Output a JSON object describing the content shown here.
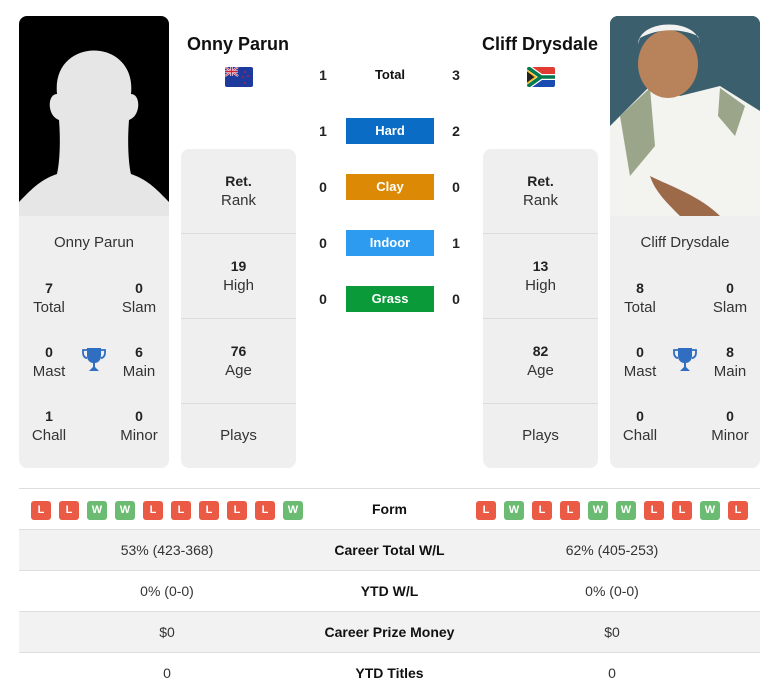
{
  "players": {
    "left": {
      "name": "Onny Parun",
      "flag": "new-zealand-flag",
      "titles": {
        "total": {
          "value": "7",
          "label": "Total"
        },
        "slam": {
          "value": "0",
          "label": "Slam"
        },
        "mast": {
          "value": "0",
          "label": "Mast"
        },
        "main": {
          "value": "6",
          "label": "Main"
        },
        "chall": {
          "value": "1",
          "label": "Chall"
        },
        "minor": {
          "value": "0",
          "label": "Minor"
        }
      },
      "rank": {
        "value": "Ret.",
        "label": "Rank"
      },
      "high": {
        "value": "19",
        "label": "High"
      },
      "age": {
        "value": "76",
        "label": "Age"
      },
      "plays": {
        "label": "Plays"
      }
    },
    "right": {
      "name": "Cliff Drysdale",
      "flag": "south-africa-flag",
      "titles": {
        "total": {
          "value": "8",
          "label": "Total"
        },
        "slam": {
          "value": "0",
          "label": "Slam"
        },
        "mast": {
          "value": "0",
          "label": "Mast"
        },
        "main": {
          "value": "8",
          "label": "Main"
        },
        "chall": {
          "value": "0",
          "label": "Chall"
        },
        "minor": {
          "value": "0",
          "label": "Minor"
        }
      },
      "rank": {
        "value": "Ret.",
        "label": "Rank"
      },
      "high": {
        "value": "13",
        "label": "High"
      },
      "age": {
        "value": "82",
        "label": "Age"
      },
      "plays": {
        "label": "Plays"
      }
    }
  },
  "h2h": [
    {
      "label": "Total",
      "left": "1",
      "right": "3",
      "color": null
    },
    {
      "label": "Hard",
      "left": "1",
      "right": "2",
      "color": "#0a6cc4"
    },
    {
      "label": "Clay",
      "left": "0",
      "right": "0",
      "color": "#dc8a05"
    },
    {
      "label": "Indoor",
      "left": "0",
      "right": "1",
      "color": "#2d9cf0"
    },
    {
      "label": "Grass",
      "left": "0",
      "right": "0",
      "color": "#0a9a3a"
    }
  ],
  "form": {
    "label": "Form",
    "left": [
      "L",
      "L",
      "W",
      "W",
      "L",
      "L",
      "L",
      "L",
      "L",
      "W"
    ],
    "right": [
      "L",
      "W",
      "L",
      "L",
      "W",
      "W",
      "L",
      "L",
      "W",
      "L"
    ]
  },
  "stats": [
    {
      "label": "Career Total W/L",
      "left": "53% (423-368)",
      "right": "62% (405-253)"
    },
    {
      "label": "YTD W/L",
      "left": "0% (0-0)",
      "right": "0% (0-0)"
    },
    {
      "label": "Career Prize Money",
      "left": "$0",
      "right": "$0"
    },
    {
      "label": "YTD Titles",
      "left": "0",
      "right": "0"
    }
  ],
  "colors": {
    "loss": "#eb5a45",
    "win": "#6bbb72",
    "trophy": "#2f6ec0"
  }
}
